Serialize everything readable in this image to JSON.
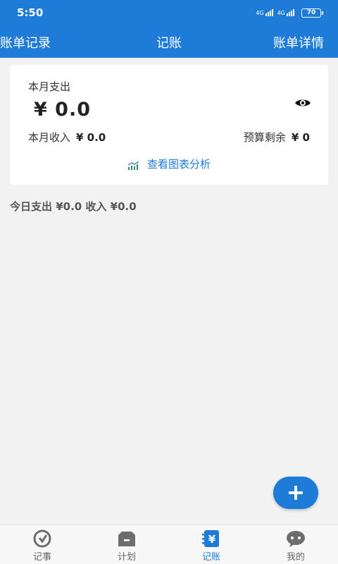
{
  "status_bar": {
    "time": "5:50",
    "network1": "4G",
    "network2": "4G",
    "battery": "70"
  },
  "header": {
    "left_label": "账单记录",
    "title": "记账",
    "right_label": "账单详情"
  },
  "summary": {
    "month_expense_label": "本月支出",
    "month_expense_value": "¥ 0.0",
    "month_income_label": "本月收入",
    "month_income_value": "¥ 0.0",
    "budget_remaining_label": "预算剩余",
    "budget_remaining_value": "¥ 0",
    "chart_link_label": "查看图表分析"
  },
  "today": {
    "text": "今日支出 ¥0.0 收入 ¥0.0"
  },
  "nav": {
    "items": [
      {
        "label": "记事",
        "icon": "notes-icon"
      },
      {
        "label": "计划",
        "icon": "plan-icon"
      },
      {
        "label": "记账",
        "icon": "ledger-icon",
        "active": true
      },
      {
        "label": "我的",
        "icon": "profile-icon"
      }
    ]
  },
  "colors": {
    "primary": "#1e7bd8",
    "background": "#f2f2f2",
    "card": "#ffffff",
    "chart_icon": "#2e8b57"
  }
}
